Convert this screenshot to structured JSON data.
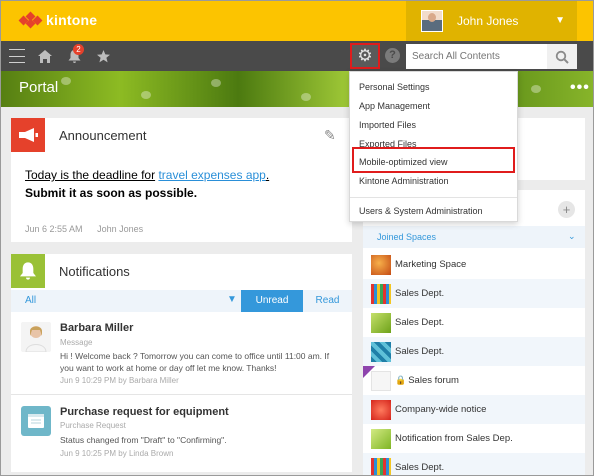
{
  "app": {
    "logo_text": "kintone",
    "brand_color": "#fcc400"
  },
  "user": {
    "name": "John Jones"
  },
  "nav": {
    "notification_count": "2",
    "search_placeholder": "Search All Contents"
  },
  "banner": {
    "title": "Portal"
  },
  "gear_menu": {
    "items": [
      "Personal Settings",
      "App Management",
      "Imported Files",
      "Exported Files",
      "Mobile-optimized view",
      "Kintone Administration",
      "Users & System Administration"
    ],
    "highlighted": "Mobile-optimized view"
  },
  "announcement": {
    "title": "Announcement",
    "line1_part1": "Today is the deadline for",
    "line1_link": "travel expenses app",
    "line1_end": ".",
    "line2": "Submit it as soon as possible.",
    "date": "Jun 6 2:55 AM",
    "author": "John Jones"
  },
  "notifications": {
    "title": "Notifications",
    "filter_all": "All",
    "unread_label": "Unread",
    "read_label": "Read",
    "items": [
      {
        "title": "Barbara Miller",
        "subtitle": "Message",
        "body": "Hi ! Welcome back ? Tomorrow you can come to office until 11:00 am. If you want to work at home or day off let me know. Thanks!",
        "date": "Jun 9 10:29 PM",
        "by": "by Barbara Miller"
      },
      {
        "title": "Purchase request for equipment",
        "subtitle": "Purchase Request",
        "body": "Status changed from \"Draft\" to \"Confirming\".",
        "date": "Jun 9 10:25 PM",
        "by": "by Linda Brown"
      }
    ]
  },
  "spaces": {
    "joined_label": "Joined Spaces",
    "items": [
      {
        "name": "Marketing Space",
        "locked": false
      },
      {
        "name": "Sales Dept.",
        "locked": false
      },
      {
        "name": "Sales Dept.",
        "locked": false
      },
      {
        "name": "Sales Dept.",
        "locked": false
      },
      {
        "name": "Sales forum",
        "locked": true
      },
      {
        "name": "Company-wide notice",
        "locked": false
      },
      {
        "name": "Notification from Sales Dep.",
        "locked": false
      },
      {
        "name": "Sales Dept.",
        "locked": false
      }
    ]
  }
}
